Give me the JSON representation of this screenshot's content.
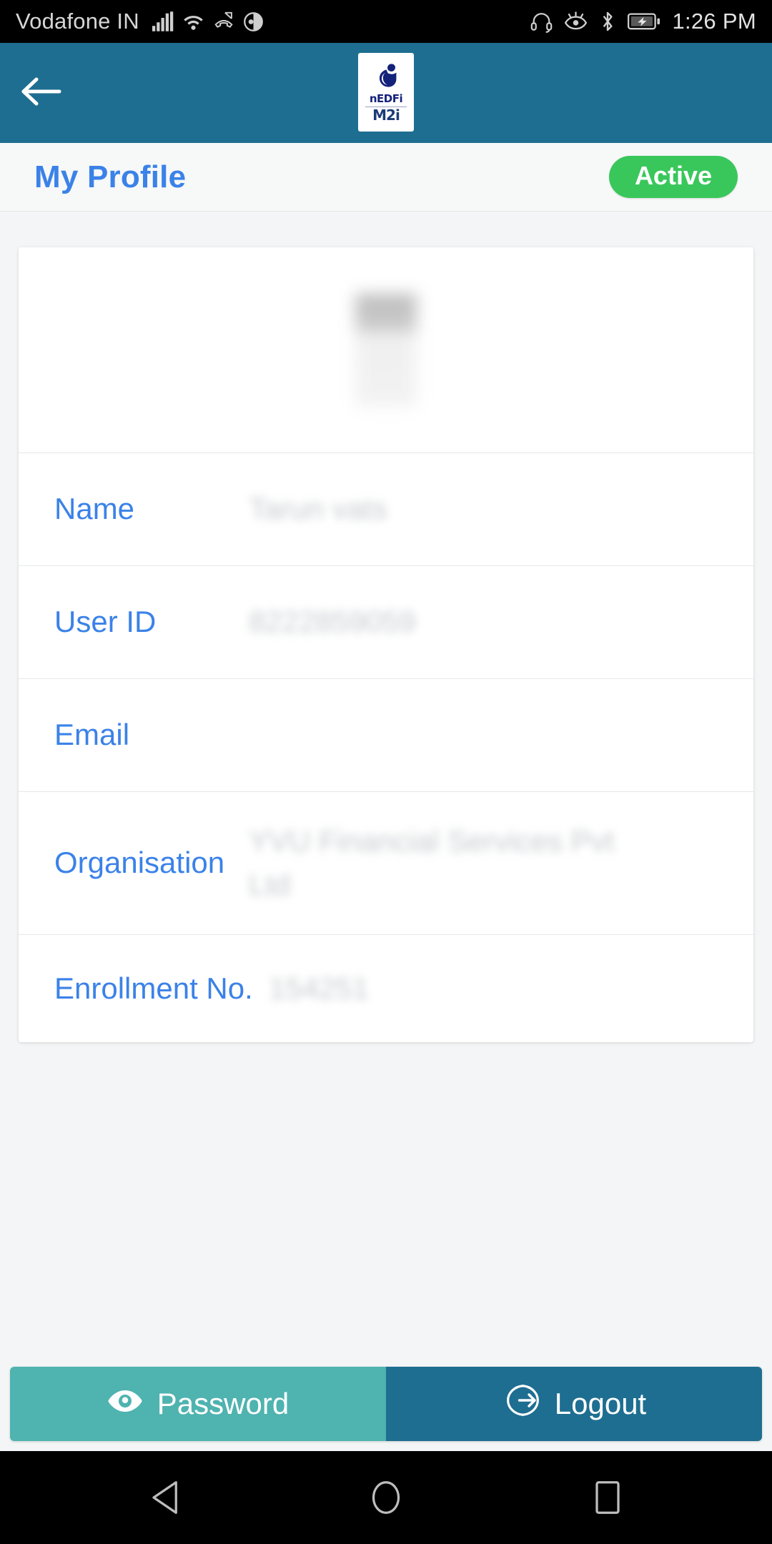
{
  "status_bar": {
    "carrier": "Vodafone IN",
    "time": "1:26 PM",
    "left_icons": [
      "signal-icon",
      "wifi-icon",
      "missed-call-icon",
      "data-saver-icon"
    ],
    "right_icons": [
      "headset-icon",
      "eye-care-icon",
      "bluetooth-icon",
      "battery-charging-icon"
    ]
  },
  "app_bar": {
    "back_icon": "back-arrow-icon",
    "logo": {
      "word": "nEDFi",
      "sub": "M2i",
      "mark": "nedfi-emblem-icon"
    },
    "background_color": "#1E6E91"
  },
  "title_bar": {
    "title": "My Profile",
    "status": "Active",
    "status_color": "#39C75B",
    "title_color": "#3B82E8"
  },
  "profile": {
    "avatar": "profile-photo",
    "rows": [
      {
        "label": "Name",
        "value": "Tarun vats"
      },
      {
        "label": "User ID",
        "value": "8222859059"
      },
      {
        "label": "Email",
        "value": ""
      },
      {
        "label": "Organisation",
        "value": "YVU Financial Services Pvt Ltd"
      },
      {
        "label": "Enrollment No.",
        "value": "154251"
      }
    ]
  },
  "actions": {
    "password": {
      "label": "Password",
      "icon": "eye-icon",
      "color": "#4FB3B0"
    },
    "logout": {
      "label": "Logout",
      "icon": "logout-icon",
      "color": "#1E6E91"
    }
  },
  "nav_bar": {
    "back": "nav-back-icon",
    "home": "nav-home-icon",
    "recents": "nav-recents-icon"
  }
}
